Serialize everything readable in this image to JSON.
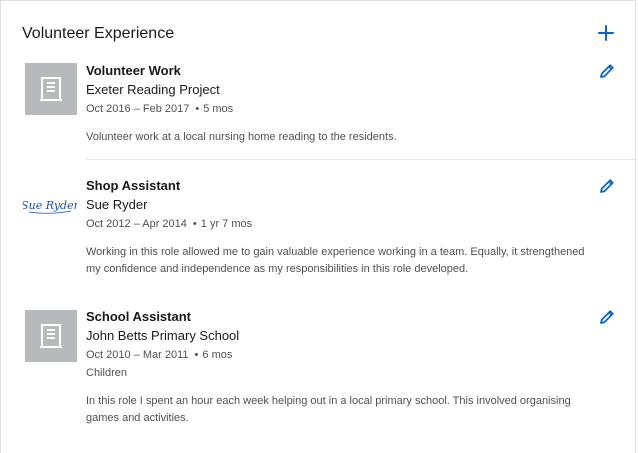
{
  "section": {
    "title": "Volunteer Experience"
  },
  "icons": {
    "add": "plus-icon",
    "edit": "pencil-icon",
    "building": "building-icon"
  },
  "colors": {
    "accent": "#0a66c2",
    "placeholder_logo": "#b7b9bb",
    "sue_ryder_brand": "#1a4f9c"
  },
  "entries": [
    {
      "role": "Volunteer Work",
      "organization": "Exeter Reading Project",
      "date_range": "Oct 2016 – Feb 2017",
      "duration": "5 mos",
      "cause": "",
      "description": "Volunteer work at a local nursing home reading to the residents.",
      "logo": "building-placeholder"
    },
    {
      "role": "Shop Assistant",
      "organization": "Sue Ryder",
      "date_range": "Oct 2012 – Apr 2014",
      "duration": "1 yr 7 mos",
      "cause": "",
      "description": "Working in this role allowed me to gain valuable experience working in a team. Equally, it strengthened my confidence and independence as my responsibilities in this role developed.",
      "logo": "sue-ryder-logo",
      "logo_text": "Sue Ryder"
    },
    {
      "role": "School Assistant",
      "organization": "John Betts Primary School",
      "date_range": "Oct 2010 – Mar 2011",
      "duration": "6 mos",
      "cause": "Children",
      "description": "In this role I spent an hour each week helping out in a local primary school. This involved organising games and activities.",
      "logo": "building-placeholder"
    }
  ]
}
